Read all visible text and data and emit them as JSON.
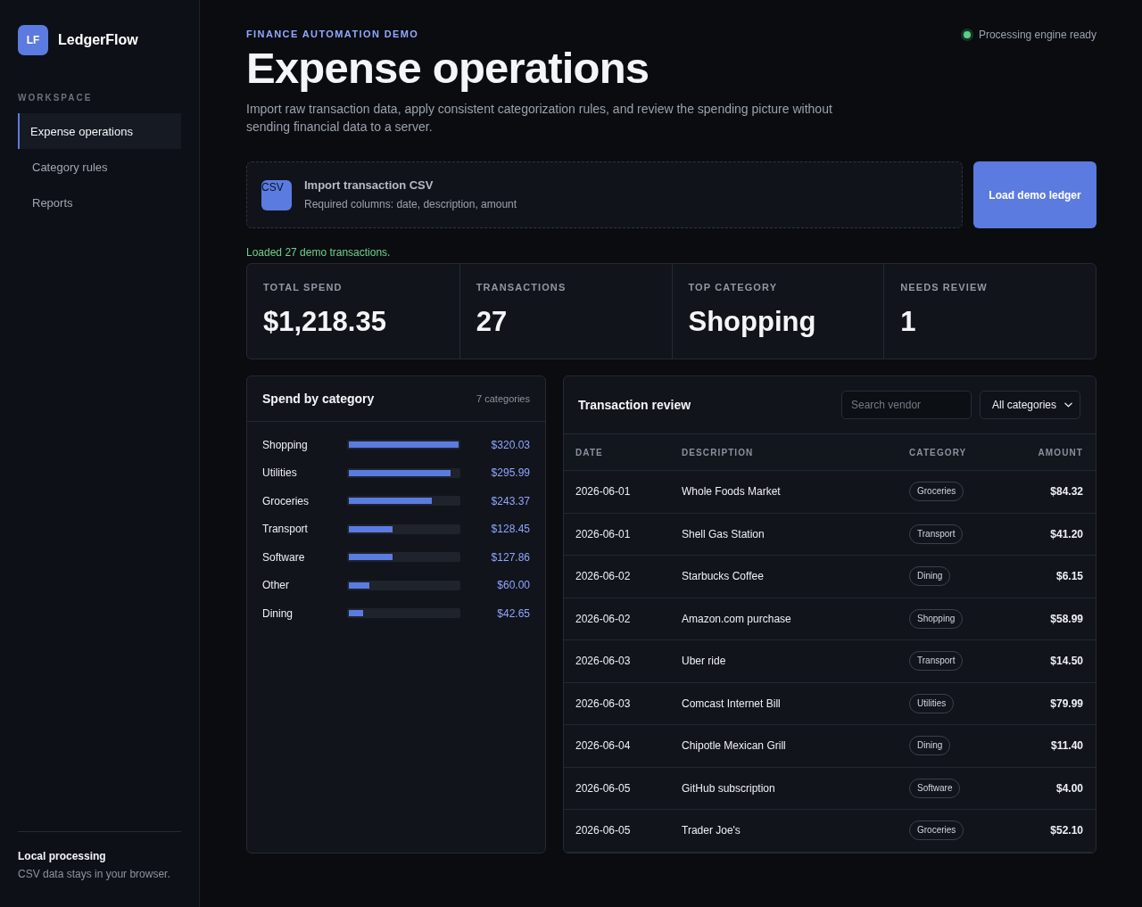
{
  "sidebar": {
    "logo": {
      "mark": "LF",
      "name": "LedgerFlow"
    },
    "section_label": "WORKSPACE",
    "items": [
      {
        "label": "Expense operations",
        "selected": true
      },
      {
        "label": "Category rules",
        "selected": false
      },
      {
        "label": "Reports",
        "selected": false
      }
    ],
    "footer": {
      "title": "Local processing",
      "text": "CSV data stays in your browser."
    }
  },
  "header": {
    "eyebrow": "FINANCE AUTOMATION DEMO",
    "title": "Expense operations",
    "description": "Import raw transaction data, apply consistent categorization rules, and review the spending picture without sending financial data to a server.",
    "status": {
      "label": "Processing engine ready",
      "ready": true
    }
  },
  "import": {
    "badge": "CSV",
    "title": "Import transaction CSV",
    "hint": "Required columns: date, description, amount",
    "button": "Load demo ledger"
  },
  "notice": "Loaded 27 demo transactions.",
  "stats": [
    {
      "label": "TOTAL SPEND",
      "value": "$1,218.35"
    },
    {
      "label": "TRANSACTIONS",
      "value": "27"
    },
    {
      "label": "TOP CATEGORY",
      "value": "Shopping"
    },
    {
      "label": "NEEDS REVIEW",
      "value": "1"
    }
  ],
  "spend_panel": {
    "title": "Spend by category",
    "count": "7 categories",
    "rows": [
      {
        "category": "Shopping",
        "level": 1,
        "amount": "$320.03"
      },
      {
        "category": "Utilities",
        "level": 0.925,
        "amount": "$295.99"
      },
      {
        "category": "Groceries",
        "level": 0.76,
        "amount": "$243.37"
      },
      {
        "category": "Transport",
        "level": 0.401,
        "amount": "$128.45"
      },
      {
        "category": "Software",
        "level": 0.4,
        "amount": "$127.86"
      },
      {
        "category": "Other",
        "level": 0.187,
        "amount": "$60.00"
      },
      {
        "category": "Dining",
        "level": 0.133,
        "amount": "$42.65"
      }
    ]
  },
  "transactions": {
    "title": "Transaction review",
    "search": {
      "placeholder": "Search vendor"
    },
    "filter": {
      "value": "All categories"
    },
    "columns": [
      "DATE",
      "DESCRIPTION",
      "CATEGORY",
      "AMOUNT"
    ],
    "rows": [
      {
        "date": "2026-06-01",
        "description": "Whole Foods Market",
        "category": "Groceries",
        "amount": "$84.32"
      },
      {
        "date": "2026-06-01",
        "description": "Shell Gas Station",
        "category": "Transport",
        "amount": "$41.20"
      },
      {
        "date": "2026-06-02",
        "description": "Starbucks Coffee",
        "category": "Dining",
        "amount": "$6.15"
      },
      {
        "date": "2026-06-02",
        "description": "Amazon.com purchase",
        "category": "Shopping",
        "amount": "$58.99"
      },
      {
        "date": "2026-06-03",
        "description": "Uber ride",
        "category": "Transport",
        "amount": "$14.50"
      },
      {
        "date": "2026-06-03",
        "description": "Comcast Internet Bill",
        "category": "Utilities",
        "amount": "$79.99"
      },
      {
        "date": "2026-06-04",
        "description": "Chipotle Mexican Grill",
        "category": "Dining",
        "amount": "$11.40"
      },
      {
        "date": "2026-06-05",
        "description": "GitHub subscription",
        "category": "Software",
        "amount": "$4.00"
      },
      {
        "date": "2026-06-05",
        "description": "Trader Joe's",
        "category": "Groceries",
        "amount": "$52.10"
      }
    ]
  }
}
